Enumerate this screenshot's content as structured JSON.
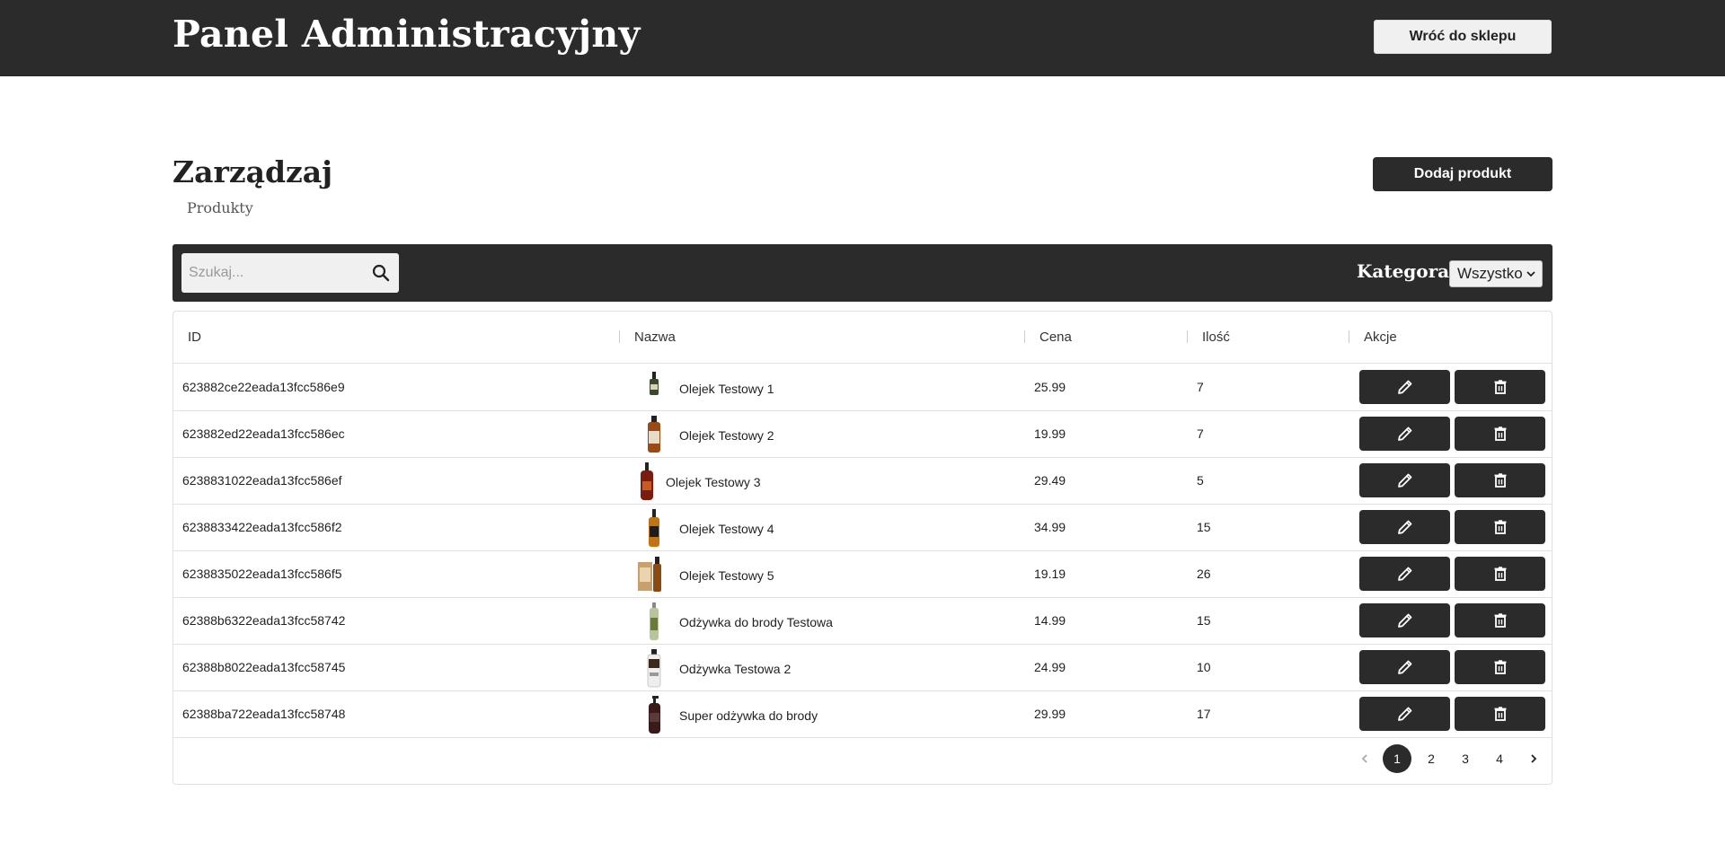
{
  "header": {
    "title": "Panel Administracyjny",
    "back_button": "Wróć do sklepu"
  },
  "page": {
    "heading": "Zarządzaj",
    "subheading": "Produkty",
    "add_button": "Dodaj produkt"
  },
  "filter": {
    "search_placeholder": "Szukaj...",
    "category_label": "Kategora:",
    "category_value": "Wszystko"
  },
  "table": {
    "columns": [
      "ID",
      "Nazwa",
      "Cena",
      "Ilość",
      "Akcje"
    ],
    "rows": [
      {
        "id": "623882ce22eada13fcc586e9",
        "name": "Olejek Testowy 1",
        "price": "25.99",
        "qty": "7"
      },
      {
        "id": "623882ed22eada13fcc586ec",
        "name": "Olejek Testowy 2",
        "price": "19.99",
        "qty": "7"
      },
      {
        "id": "6238831022eada13fcc586ef",
        "name": "Olejek Testowy 3",
        "price": "29.49",
        "qty": "5"
      },
      {
        "id": "6238833422eada13fcc586f2",
        "name": "Olejek Testowy 4",
        "price": "34.99",
        "qty": "15"
      },
      {
        "id": "6238835022eada13fcc586f5",
        "name": "Olejek Testowy 5",
        "price": "19.19",
        "qty": "26"
      },
      {
        "id": "62388b6322eada13fcc58742",
        "name": "Odżywka do brody Testowa",
        "price": "14.99",
        "qty": "15"
      },
      {
        "id": "62388b8022eada13fcc58745",
        "name": "Odżywka Testowa 2",
        "price": "24.99",
        "qty": "10"
      },
      {
        "id": "62388ba722eada13fcc58748",
        "name": "Super odżywka do brody",
        "price": "29.99",
        "qty": "17"
      }
    ]
  },
  "pagination": {
    "pages": [
      "1",
      "2",
      "3",
      "4"
    ],
    "current": "1"
  },
  "colors": {
    "dark": "#2b2b2b",
    "light": "#f0f0f0"
  }
}
